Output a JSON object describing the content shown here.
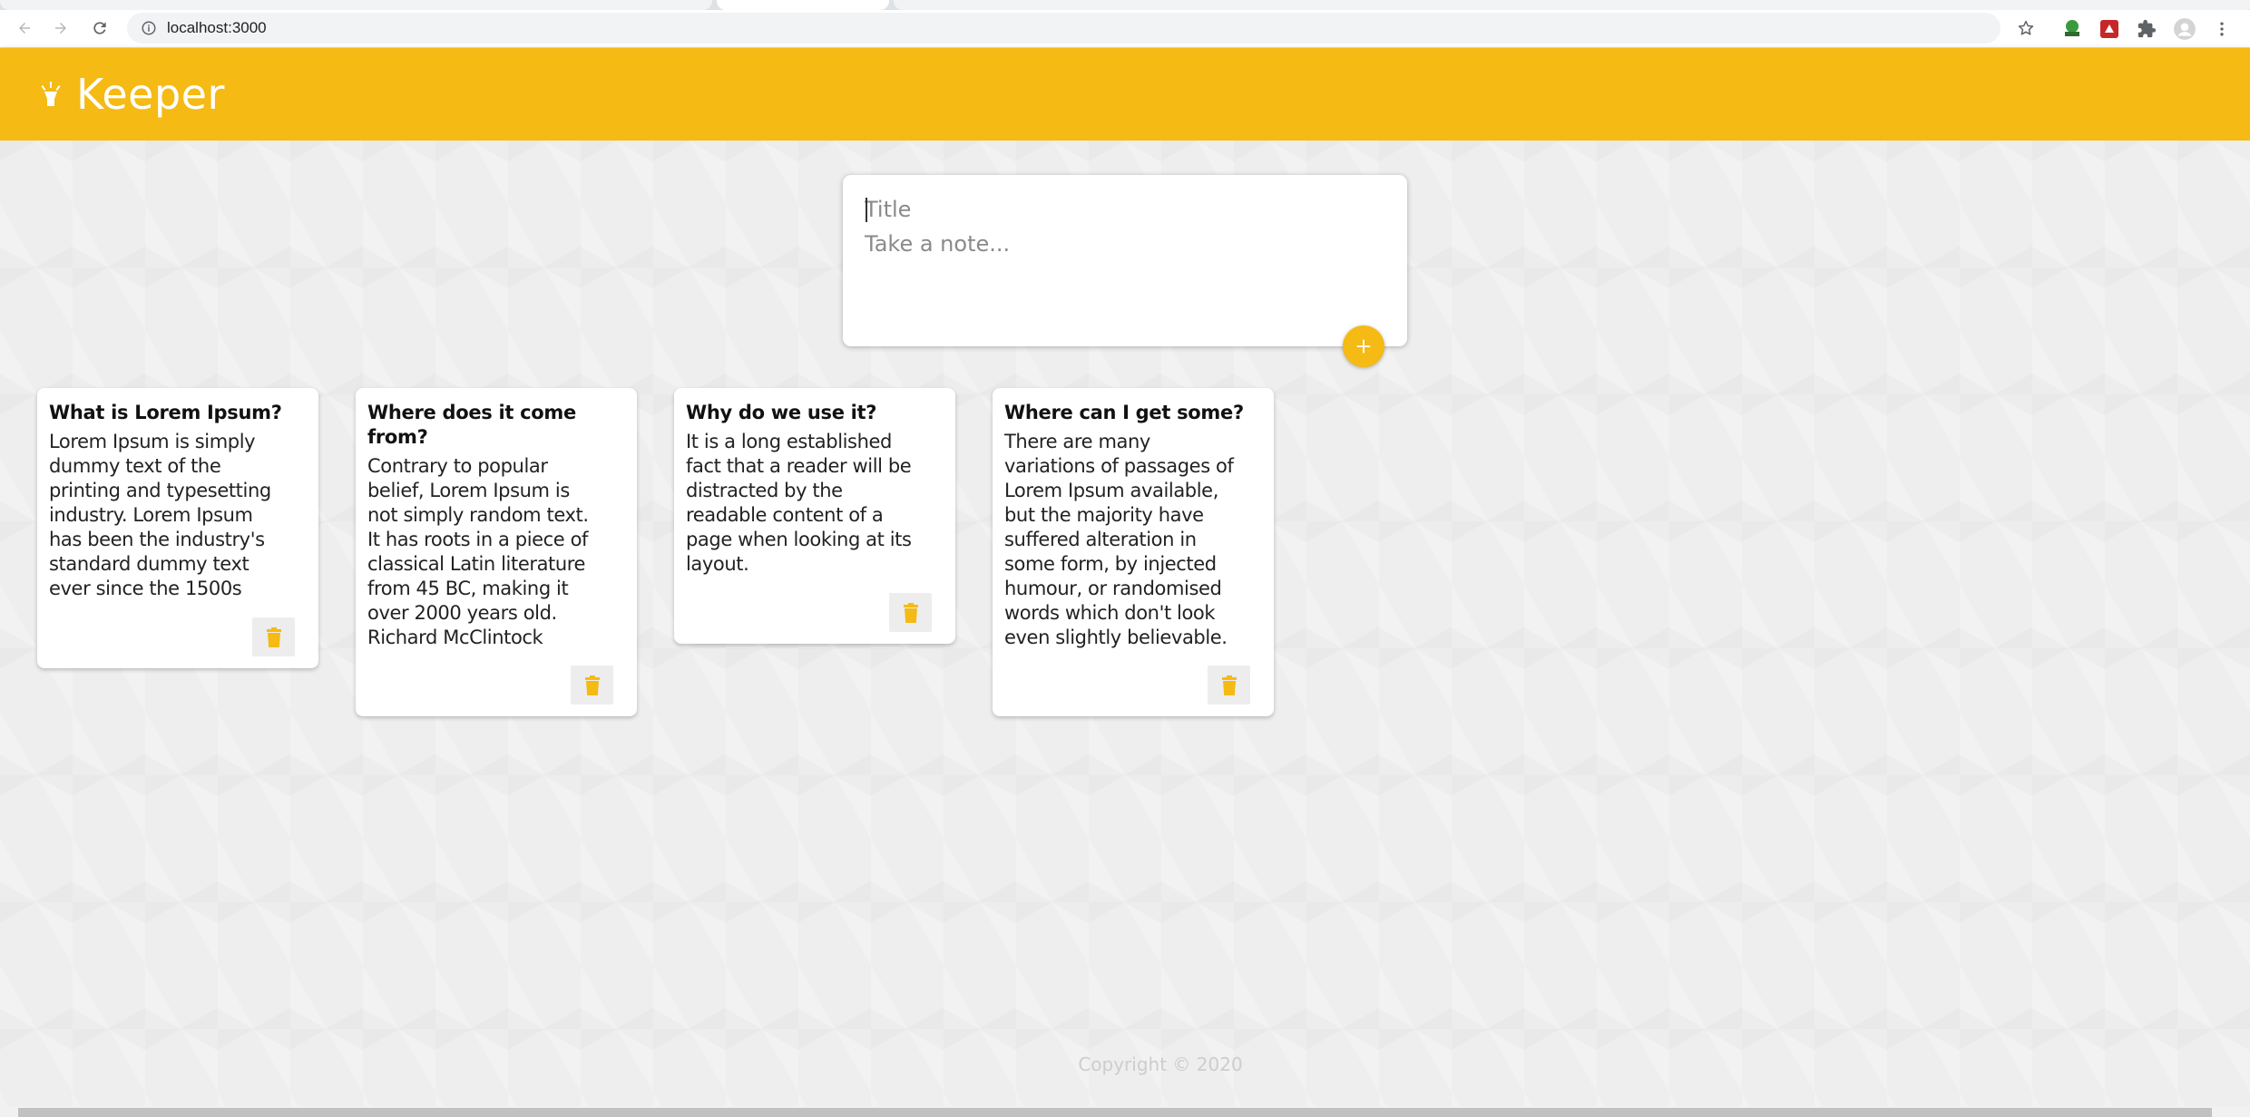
{
  "browser": {
    "url": "localhost:3000"
  },
  "app": {
    "title": "Keeper",
    "accent_color": "#f5ba13"
  },
  "create_note": {
    "title_placeholder": "Title",
    "content_placeholder": "Take a note..."
  },
  "notes": [
    {
      "title": "What is Lorem Ipsum?",
      "content": "Lorem Ipsum is simply\ndummy text of the\nprinting and typesetting\nindustry. Lorem Ipsum\nhas been the industry's\nstandard dummy text\never since the 1500s"
    },
    {
      "title": "Where does it come\nfrom?",
      "content": "Contrary to popular\nbelief, Lorem Ipsum is\nnot simply random text.\nIt has roots in a piece of\nclassical Latin literature\nfrom 45 BC, making it\nover 2000 years old.\nRichard McClintock"
    },
    {
      "title": "Why do we use it?",
      "content": "It is a long established\nfact that a reader will be\ndistracted by the\nreadable content of a\npage when looking at its\nlayout."
    },
    {
      "title": "Where can I get some?",
      "content": "There are many\nvariations of passages of\nLorem Ipsum available,\nbut the majority have\nsuffered alteration in\nsome form, by injected\nhumour, or randomised\nwords which don't look\neven slightly believable."
    }
  ],
  "footer": {
    "text": "Copyright © 2020"
  },
  "icons": {
    "back": "arrow-left-icon",
    "forward": "arrow-right-icon",
    "reload": "reload-icon",
    "info": "info-icon",
    "bookmark": "star-icon",
    "extensions": "puzzle-icon",
    "profile": "avatar-icon",
    "menu": "kebab-menu-icon",
    "logo": "highlight-icon",
    "add": "plus-icon",
    "delete": "trash-icon"
  }
}
